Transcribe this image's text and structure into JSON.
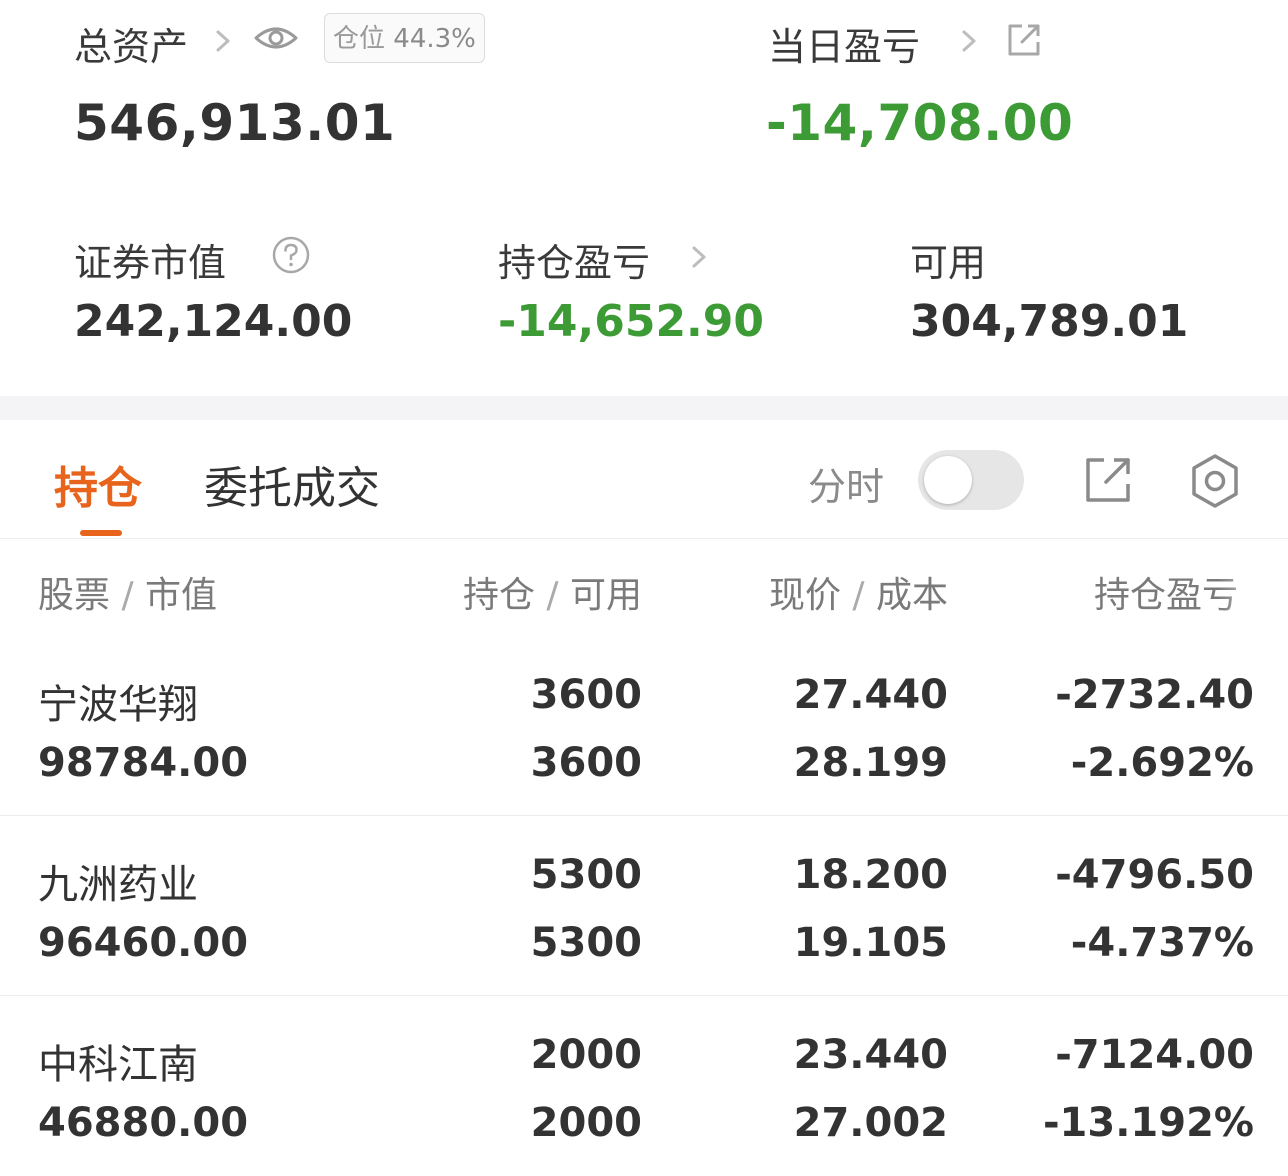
{
  "summary": {
    "total_assets": {
      "label": "总资产",
      "value": "546,913.01",
      "position_badge": {
        "label": "仓位",
        "value": "44.3%"
      }
    },
    "daily_pnl": {
      "label": "当日盈亏",
      "value": "-14,708.00"
    },
    "market_value": {
      "label": "证券市值",
      "value": "242,124.00"
    },
    "holding_pnl": {
      "label": "持仓盈亏",
      "value": "-14,652.90"
    },
    "available": {
      "label": "可用",
      "value": "304,789.01"
    }
  },
  "tabs": [
    {
      "label": "持仓",
      "active": true
    },
    {
      "label": "委托成交",
      "active": false
    }
  ],
  "toolbar": {
    "timeshare_label": "分时",
    "timeshare_on": false
  },
  "table": {
    "headers": [
      {
        "main": "股票",
        "sub": "市值"
      },
      {
        "main": "持仓",
        "sub": "可用"
      },
      {
        "main": "现价",
        "sub": "成本"
      },
      {
        "main": "持仓盈亏"
      }
    ],
    "rows": [
      {
        "name": "宁波华翔",
        "market_value": "98784.00",
        "holding": "3600",
        "available": "3600",
        "price": "27.440",
        "cost": "28.199",
        "pnl": "-2732.40",
        "pnl_pct": "-2.692%"
      },
      {
        "name": "九洲药业",
        "market_value": "96460.00",
        "holding": "5300",
        "available": "5300",
        "price": "18.200",
        "cost": "19.105",
        "pnl": "-4796.50",
        "pnl_pct": "-4.737%"
      },
      {
        "name": "中科江南",
        "market_value": "46880.00",
        "holding": "2000",
        "available": "2000",
        "price": "23.440",
        "cost": "27.002",
        "pnl": "-7124.00",
        "pnl_pct": "-13.192%"
      }
    ]
  },
  "colors": {
    "loss_green": "#3d9b35",
    "accent_orange": "#e8641c"
  }
}
